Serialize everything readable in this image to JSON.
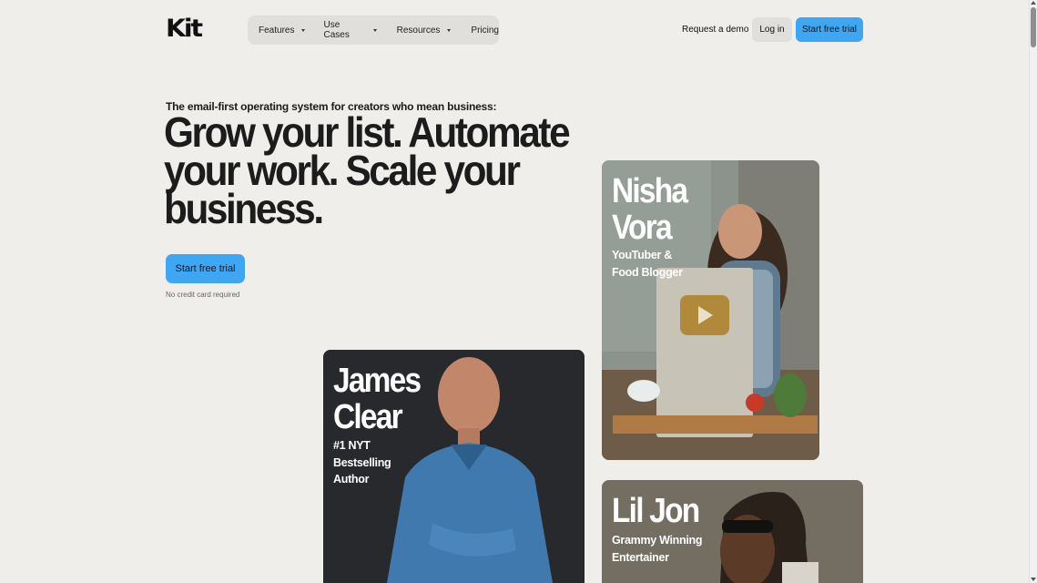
{
  "brand": {
    "logo_text": "Kit"
  },
  "nav": {
    "items": [
      {
        "label": "Features",
        "has_dropdown": true
      },
      {
        "label": "Use Cases",
        "has_dropdown": true
      },
      {
        "label": "Resources",
        "has_dropdown": true
      },
      {
        "label": "Pricing",
        "has_dropdown": false
      }
    ],
    "request_demo": "Request a demo",
    "login": "Log in",
    "start_trial": "Start free trial"
  },
  "hero": {
    "eyebrow": "The email-first operating system for creators who mean business:",
    "headline_lines": [
      "Grow your list. Automate",
      "your work. Scale your",
      "business."
    ],
    "cta": "Start free trial",
    "note": "No credit card required"
  },
  "cards": {
    "nisha": {
      "name_lines": [
        "Nisha",
        "Vora"
      ],
      "sub_lines": [
        "YouTuber &",
        "Food Blogger"
      ]
    },
    "james": {
      "name_lines": [
        "James",
        "Clear"
      ],
      "sub_lines": [
        "#1 NYT",
        "Bestselling",
        "Author"
      ]
    },
    "liljon": {
      "name_lines": [
        "Lil Jon"
      ],
      "sub_lines": [
        "Grammy Winning",
        "Entertainer"
      ]
    }
  },
  "colors": {
    "background": "#efeeea",
    "accent": "#3ea6f2",
    "nav_bg": "#e0dfdb",
    "text": "#1c1c1c"
  }
}
